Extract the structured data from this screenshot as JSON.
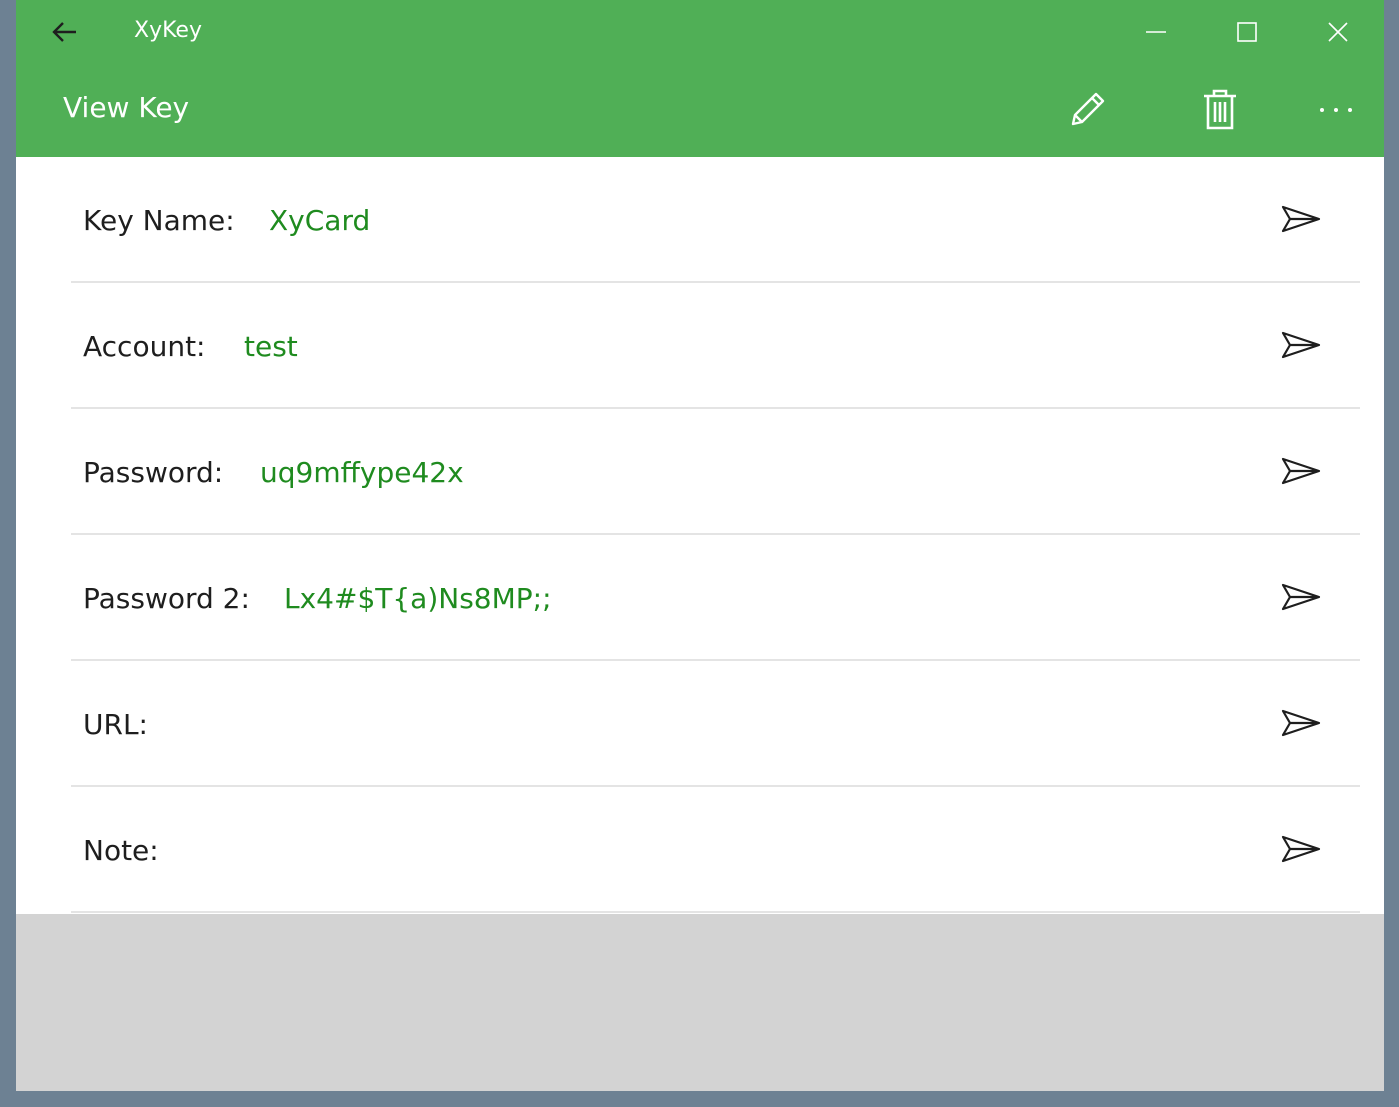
{
  "window": {
    "app_title": "XyKey",
    "controls": [
      "minimize-icon",
      "maximize-icon",
      "close-icon"
    ]
  },
  "header": {
    "back_icon": "arrow-left-icon",
    "page_title": "View Key",
    "commands": [
      "pencil-icon",
      "trash-icon",
      "more-icon"
    ]
  },
  "fields": [
    {
      "label": "Key Name:",
      "value": "XyCard"
    },
    {
      "label": "Account:",
      "value": "test"
    },
    {
      "label": "Password:",
      "value": "uq9mffype42x"
    },
    {
      "label": "Password 2:",
      "value": "Lx4#$T{a)Ns8MP;;"
    },
    {
      "label": "URL:",
      "value": ""
    },
    {
      "label": "Note:",
      "value": ""
    }
  ],
  "send_icon": "send-icon",
  "colors": {
    "accent": "#50af56",
    "value_text": "#1f8b1f",
    "label_text": "#1e1e1e",
    "empty_area": "#d3d3d3",
    "window_border": "#6d8193"
  }
}
